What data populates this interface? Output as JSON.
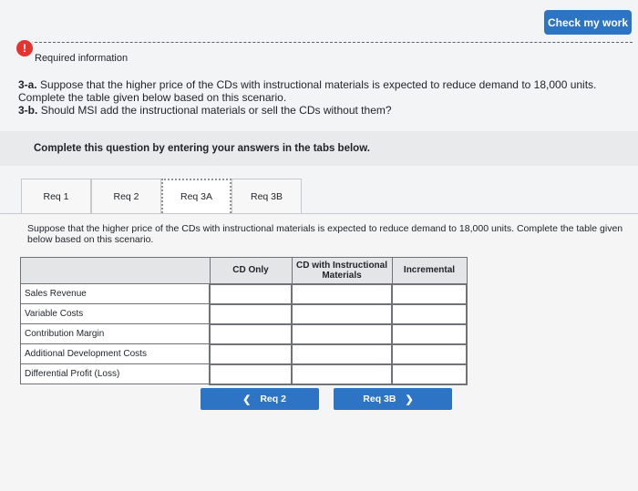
{
  "header": {
    "check_label": "Check my work"
  },
  "required_info": {
    "icon": "info-icon",
    "label": "Required information"
  },
  "question": {
    "part_a_prefix": "3-a.",
    "part_a_text": "Suppose that the higher price of the CDs with instructional materials is expected to reduce demand to 18,000 units. Complete the table given below based on this scenario.",
    "part_b_prefix": "3-b.",
    "part_b_text": "Should MSI add the instructional materials or sell the CDs without them?"
  },
  "instructions": "Complete this question by entering your answers in the tabs below.",
  "tabs": [
    {
      "label": "Req 1"
    },
    {
      "label": "Req 2"
    },
    {
      "label": "Req 3A"
    },
    {
      "label": "Req 3B"
    }
  ],
  "tab_content": {
    "description": "Suppose that the higher price of the CDs with instructional materials is expected to reduce demand to 18,000 units. Complete the table given below based on this scenario."
  },
  "table": {
    "headers": [
      "",
      "CD Only",
      "CD with Instructional Materials",
      "Incremental"
    ],
    "rows": [
      "Sales Revenue",
      "Variable Costs",
      "Contribution Margin",
      "Additional Development Costs",
      "Differential Profit (Loss)"
    ]
  },
  "nav": {
    "prev_label": "Req 2",
    "next_label": "Req 3B"
  },
  "colors": {
    "accent": "#2d74c4",
    "info": "#e3342f"
  }
}
